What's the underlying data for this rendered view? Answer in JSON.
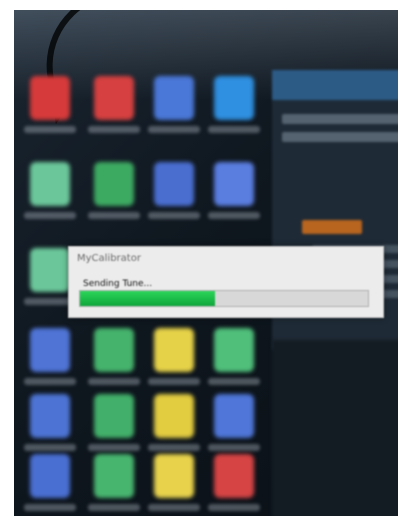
{
  "dialog": {
    "title": "MyCalibrator",
    "message": "Sending Tune...",
    "progress": 0.47,
    "progress_color": "#1cc04a"
  },
  "desktop": {
    "icons": [
      {
        "name": "red-app-icon",
        "color": "#d63a3a"
      },
      {
        "name": "red-app-icon",
        "color": "#d64040"
      },
      {
        "name": "document-icon",
        "color": "#4a78d8"
      },
      {
        "name": "blue-app-icon",
        "color": "#2f8fe0"
      },
      {
        "name": "green-app-icon",
        "color": "#6bc79a"
      },
      {
        "name": "green-app-icon",
        "color": "#3daa62"
      },
      {
        "name": "document-icon",
        "color": "#4a6ed0"
      },
      {
        "name": "document-icon",
        "color": "#5a7de0"
      },
      {
        "name": "green-app-icon",
        "color": "#6bc79a"
      },
      {
        "name": "document-icon",
        "color": "#4f74d6"
      },
      {
        "name": "green-app-icon",
        "color": "#45b36c"
      },
      {
        "name": "yellow-app-icon",
        "color": "#e6d248"
      },
      {
        "name": "green-app-icon",
        "color": "#4fbf7a"
      },
      {
        "name": "document-icon",
        "color": "#4d74d4"
      },
      {
        "name": "green-app-icon",
        "color": "#42b06a"
      },
      {
        "name": "yellow-app-icon",
        "color": "#e2cc40"
      },
      {
        "name": "document-icon",
        "color": "#4f76d8"
      },
      {
        "name": "document-icon",
        "color": "#4a6fd2"
      },
      {
        "name": "green-app-icon",
        "color": "#48b56f"
      },
      {
        "name": "yellow-app-icon",
        "color": "#e8d24c"
      },
      {
        "name": "red-app-icon",
        "color": "#d64444"
      }
    ]
  },
  "explorer": {
    "title_color": "#2c5b86",
    "selected_color": "#b8651f"
  }
}
